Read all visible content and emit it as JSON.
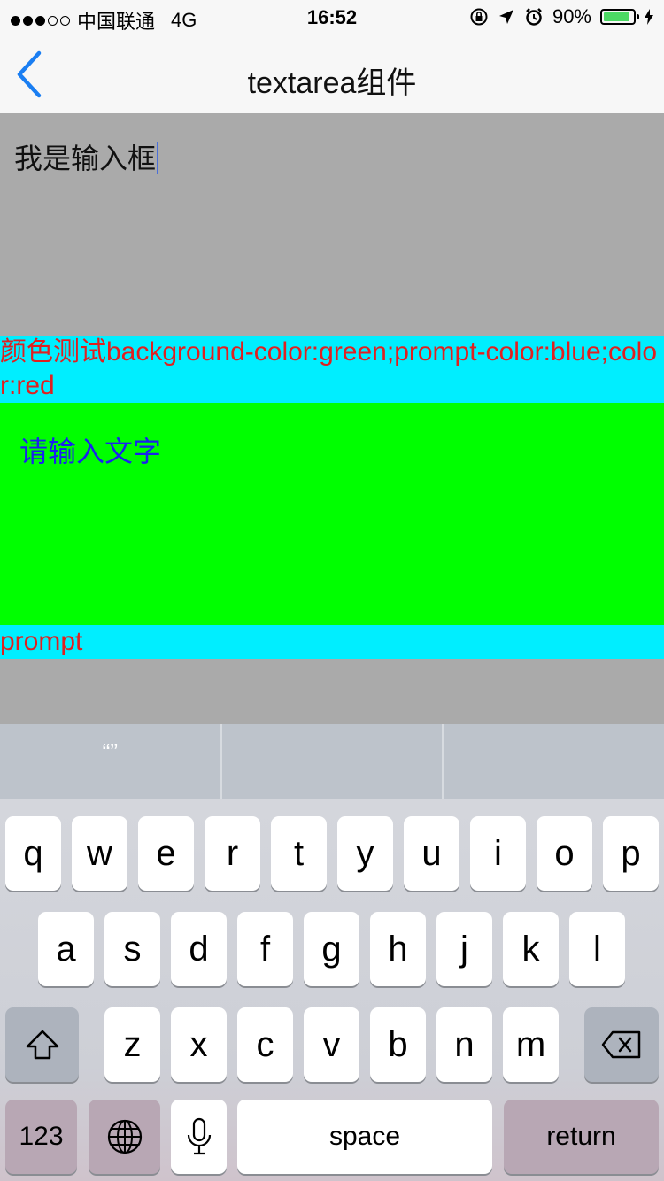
{
  "status_bar": {
    "carrier": "中国联通",
    "network": "4G",
    "time": "16:52",
    "battery_percent": "90%",
    "battery_level": 0.9
  },
  "nav": {
    "title": "textarea组件"
  },
  "textarea1": {
    "value": "我是输入框"
  },
  "label1": {
    "text": "颜色测试background-color:green;prompt-color:blue;color:red"
  },
  "textarea2": {
    "placeholder": "请输入文字"
  },
  "label2": {
    "text": "prompt"
  },
  "suggestions": [
    "“”",
    "",
    ""
  ],
  "keyboard": {
    "row1": [
      "q",
      "w",
      "e",
      "r",
      "t",
      "y",
      "u",
      "i",
      "o",
      "p"
    ],
    "row2": [
      "a",
      "s",
      "d",
      "f",
      "g",
      "h",
      "j",
      "k",
      "l"
    ],
    "row3": [
      "z",
      "x",
      "c",
      "v",
      "b",
      "n",
      "m"
    ],
    "numbers_label": "123",
    "space_label": "space",
    "return_label": "return"
  },
  "colors": {
    "accent": "#1a7ef2",
    "label_bg": "#00eeff",
    "label_text": "#e02020",
    "textarea2_bg": "#00ff00",
    "textarea2_placeholder": "#1a22ee"
  }
}
